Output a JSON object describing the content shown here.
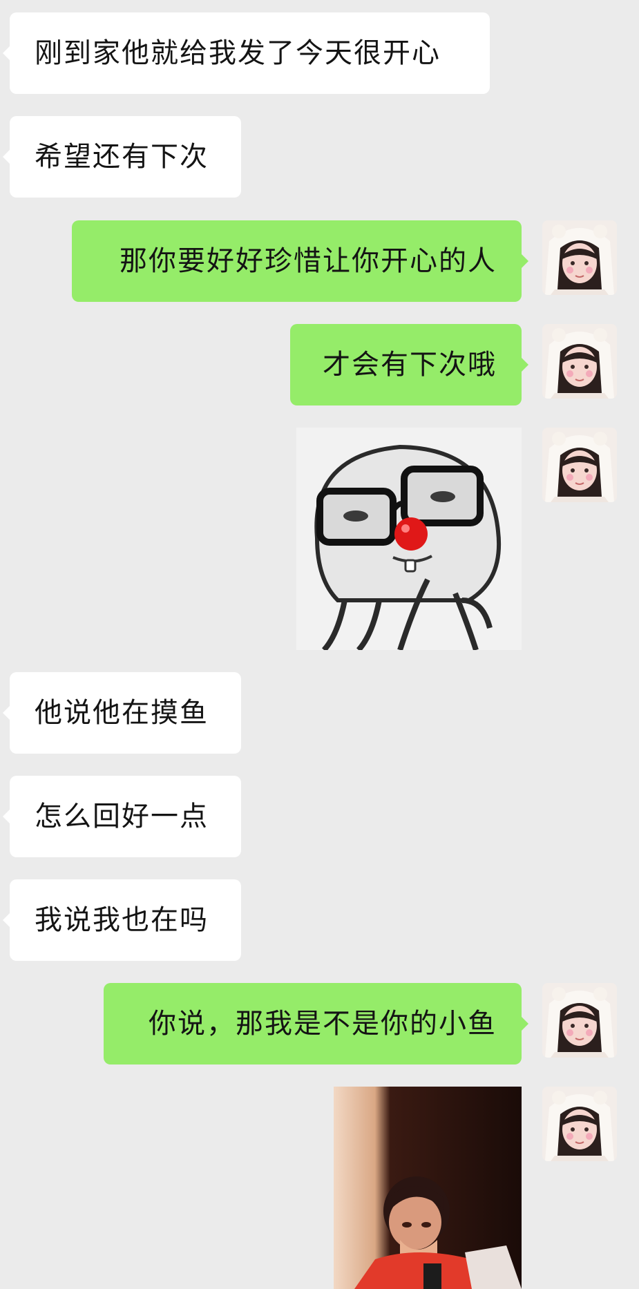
{
  "chat": {
    "messages": [
      {
        "side": "in",
        "type": "text",
        "text": "刚到家他就给我发了今天很开心"
      },
      {
        "side": "in",
        "type": "text",
        "text": "希望还有下次"
      },
      {
        "side": "out",
        "type": "text",
        "text": "那你要好好珍惜让你开心的人"
      },
      {
        "side": "out",
        "type": "text",
        "text": "才会有下次哦"
      },
      {
        "side": "out",
        "type": "image",
        "image": "clown-glasses-sticker"
      },
      {
        "side": "in",
        "type": "text",
        "text": "他说他在摸鱼"
      },
      {
        "side": "in",
        "type": "text",
        "text": "怎么回好一点"
      },
      {
        "side": "in",
        "type": "text",
        "text": "我说我也在吗"
      },
      {
        "side": "out",
        "type": "text",
        "text": "你说，那我是不是你的小鱼"
      },
      {
        "side": "out",
        "type": "image",
        "image": "laughing-girl-photo"
      }
    ]
  },
  "colors": {
    "background": "#ebebeb",
    "incoming_bubble": "#ffffff",
    "outgoing_bubble": "#95ec69",
    "text": "#141414"
  }
}
